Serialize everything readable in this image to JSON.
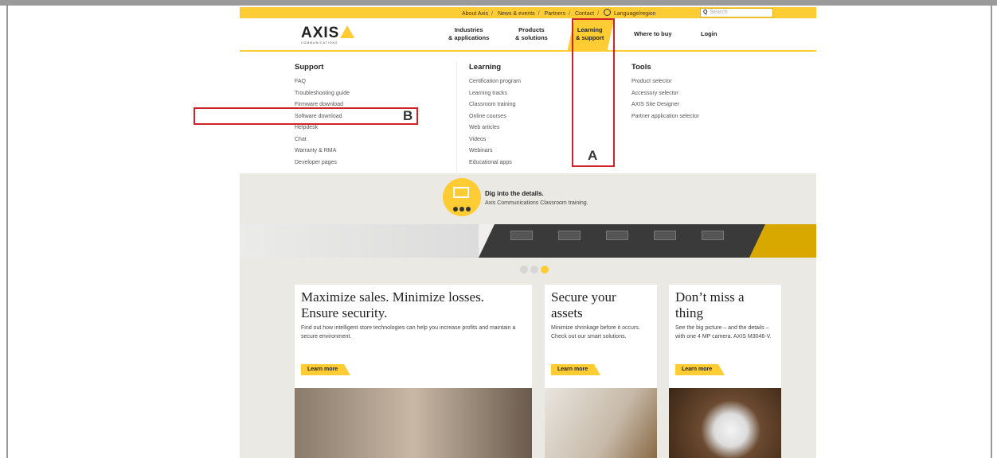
{
  "utility_nav": {
    "links": [
      "About Axis",
      "News & events",
      "Partners",
      "Contact"
    ],
    "language": "Language/region",
    "search_placeholder": "Search"
  },
  "brand": {
    "name": "AXIS",
    "tagline": "COMMUNICATIONS"
  },
  "main_nav": {
    "industries": "Industries\n& applications",
    "products": "Products\n& solutions",
    "learning": "Learning\n& support",
    "where_to_buy": "Where to buy",
    "login": "Login"
  },
  "dropdown": {
    "support": {
      "heading": "Support",
      "links": [
        "FAQ",
        "Troubleshooting guide",
        "Firmware download",
        "Software download",
        "Helpdesk",
        "Chat",
        "Warranty & RMA",
        "Developer pages"
      ]
    },
    "learning": {
      "heading": "Learning",
      "links": [
        "Certification program",
        "Learning tracks",
        "Classroom training",
        "Online courses",
        "Web articles",
        "Videos",
        "Webinars",
        "Educational apps"
      ]
    },
    "tools": {
      "heading": "Tools",
      "links": [
        "Product selector",
        "Accessory selector",
        "AXIS Site Designer",
        "Partner application selector"
      ]
    }
  },
  "promo": {
    "title": "Dig into the details.",
    "subtitle": "Axis Communications Classroom training."
  },
  "cards": [
    {
      "title": "Maximize sales. Minimize losses. Ensure security.",
      "body": "Find out how intelligent store technologies can help you increase profits and maintain a secure environment.",
      "button": "Learn more"
    },
    {
      "title": "Secure your assets",
      "body": "Minimize shrinkage before it occurs. Check out our smart solutions.",
      "button": "Learn more"
    },
    {
      "title": "Don’t miss a thing",
      "body": "See the big picture – and the details – with one 4 MP camera. AXIS M3046-V.",
      "button": "Learn more"
    }
  ],
  "annotations": {
    "a": "A",
    "b": "B"
  },
  "colors": {
    "brand_yellow": "#ffcc33",
    "annotation_red": "#d0202a"
  }
}
